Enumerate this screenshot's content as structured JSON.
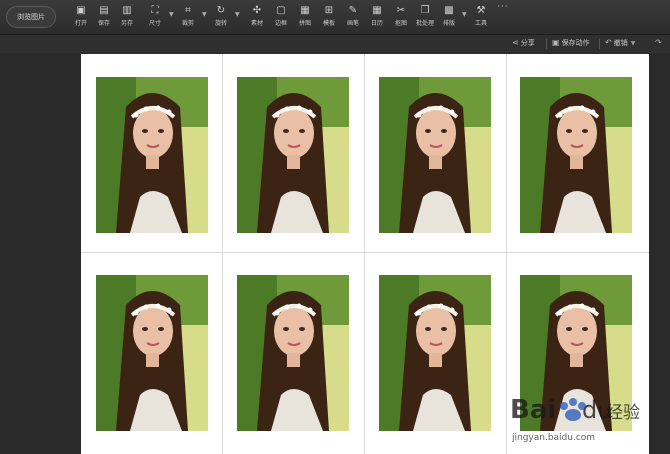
{
  "browse_button": "浏览图片",
  "tools": [
    {
      "label": "打开",
      "icon": "open-icon"
    },
    {
      "label": "保存",
      "icon": "save-icon"
    },
    {
      "label": "另存",
      "icon": "save-as-icon"
    },
    {
      "label": "尺寸",
      "icon": "resize-icon"
    },
    {
      "label": "裁剪",
      "icon": "crop-icon"
    },
    {
      "label": "旋转",
      "icon": "rotate-icon"
    },
    {
      "label": "素材",
      "icon": "stickers-icon"
    },
    {
      "label": "边框",
      "icon": "frame-icon"
    },
    {
      "label": "拼图",
      "icon": "collage-icon"
    },
    {
      "label": "模板",
      "icon": "template-icon"
    },
    {
      "label": "画笔",
      "icon": "brush-icon"
    },
    {
      "label": "日历",
      "icon": "calendar-icon"
    },
    {
      "label": "抠图",
      "icon": "cutout-icon"
    },
    {
      "label": "批处理",
      "icon": "batch-icon"
    },
    {
      "label": "排版",
      "icon": "layout-icon"
    },
    {
      "label": "工具",
      "icon": "tools-icon"
    }
  ],
  "more": "···",
  "subbar": {
    "share": "分享",
    "save_action": "保存动作",
    "undo": "撤销"
  },
  "watermark": {
    "brand": "Bai",
    "brand2": "du",
    "cn": "经验",
    "url": "jingyan.baidu.com"
  },
  "photo_count": 8
}
